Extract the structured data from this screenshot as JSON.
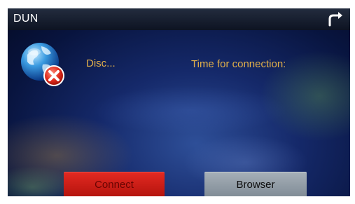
{
  "window": {
    "title": "DUN",
    "back_icon": "back-return-icon"
  },
  "status": {
    "icon": "globe-disconnected-icon",
    "text": "Disc...",
    "time_label": "Time for connection:",
    "time_value": ""
  },
  "buttons": {
    "connect_label": "Connect",
    "browser_label": "Browser"
  },
  "colors": {
    "status_text": "#e3b04a",
    "connect_button": "#d21c16",
    "browser_button": "#94a0a9",
    "background": "#0b1a4f"
  }
}
